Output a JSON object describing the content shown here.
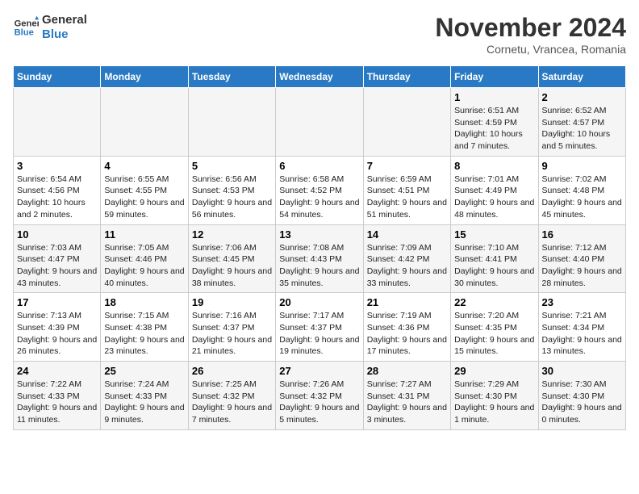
{
  "logo": {
    "line1": "General",
    "line2": "Blue"
  },
  "title": "November 2024",
  "location": "Cornetu, Vrancea, Romania",
  "days_of_week": [
    "Sunday",
    "Monday",
    "Tuesday",
    "Wednesday",
    "Thursday",
    "Friday",
    "Saturday"
  ],
  "weeks": [
    [
      {
        "day": "",
        "info": ""
      },
      {
        "day": "",
        "info": ""
      },
      {
        "day": "",
        "info": ""
      },
      {
        "day": "",
        "info": ""
      },
      {
        "day": "",
        "info": ""
      },
      {
        "day": "1",
        "info": "Sunrise: 6:51 AM\nSunset: 4:59 PM\nDaylight: 10 hours and 7 minutes."
      },
      {
        "day": "2",
        "info": "Sunrise: 6:52 AM\nSunset: 4:57 PM\nDaylight: 10 hours and 5 minutes."
      }
    ],
    [
      {
        "day": "3",
        "info": "Sunrise: 6:54 AM\nSunset: 4:56 PM\nDaylight: 10 hours and 2 minutes."
      },
      {
        "day": "4",
        "info": "Sunrise: 6:55 AM\nSunset: 4:55 PM\nDaylight: 9 hours and 59 minutes."
      },
      {
        "day": "5",
        "info": "Sunrise: 6:56 AM\nSunset: 4:53 PM\nDaylight: 9 hours and 56 minutes."
      },
      {
        "day": "6",
        "info": "Sunrise: 6:58 AM\nSunset: 4:52 PM\nDaylight: 9 hours and 54 minutes."
      },
      {
        "day": "7",
        "info": "Sunrise: 6:59 AM\nSunset: 4:51 PM\nDaylight: 9 hours and 51 minutes."
      },
      {
        "day": "8",
        "info": "Sunrise: 7:01 AM\nSunset: 4:49 PM\nDaylight: 9 hours and 48 minutes."
      },
      {
        "day": "9",
        "info": "Sunrise: 7:02 AM\nSunset: 4:48 PM\nDaylight: 9 hours and 45 minutes."
      }
    ],
    [
      {
        "day": "10",
        "info": "Sunrise: 7:03 AM\nSunset: 4:47 PM\nDaylight: 9 hours and 43 minutes."
      },
      {
        "day": "11",
        "info": "Sunrise: 7:05 AM\nSunset: 4:46 PM\nDaylight: 9 hours and 40 minutes."
      },
      {
        "day": "12",
        "info": "Sunrise: 7:06 AM\nSunset: 4:45 PM\nDaylight: 9 hours and 38 minutes."
      },
      {
        "day": "13",
        "info": "Sunrise: 7:08 AM\nSunset: 4:43 PM\nDaylight: 9 hours and 35 minutes."
      },
      {
        "day": "14",
        "info": "Sunrise: 7:09 AM\nSunset: 4:42 PM\nDaylight: 9 hours and 33 minutes."
      },
      {
        "day": "15",
        "info": "Sunrise: 7:10 AM\nSunset: 4:41 PM\nDaylight: 9 hours and 30 minutes."
      },
      {
        "day": "16",
        "info": "Sunrise: 7:12 AM\nSunset: 4:40 PM\nDaylight: 9 hours and 28 minutes."
      }
    ],
    [
      {
        "day": "17",
        "info": "Sunrise: 7:13 AM\nSunset: 4:39 PM\nDaylight: 9 hours and 26 minutes."
      },
      {
        "day": "18",
        "info": "Sunrise: 7:15 AM\nSunset: 4:38 PM\nDaylight: 9 hours and 23 minutes."
      },
      {
        "day": "19",
        "info": "Sunrise: 7:16 AM\nSunset: 4:37 PM\nDaylight: 9 hours and 21 minutes."
      },
      {
        "day": "20",
        "info": "Sunrise: 7:17 AM\nSunset: 4:37 PM\nDaylight: 9 hours and 19 minutes."
      },
      {
        "day": "21",
        "info": "Sunrise: 7:19 AM\nSunset: 4:36 PM\nDaylight: 9 hours and 17 minutes."
      },
      {
        "day": "22",
        "info": "Sunrise: 7:20 AM\nSunset: 4:35 PM\nDaylight: 9 hours and 15 minutes."
      },
      {
        "day": "23",
        "info": "Sunrise: 7:21 AM\nSunset: 4:34 PM\nDaylight: 9 hours and 13 minutes."
      }
    ],
    [
      {
        "day": "24",
        "info": "Sunrise: 7:22 AM\nSunset: 4:33 PM\nDaylight: 9 hours and 11 minutes."
      },
      {
        "day": "25",
        "info": "Sunrise: 7:24 AM\nSunset: 4:33 PM\nDaylight: 9 hours and 9 minutes."
      },
      {
        "day": "26",
        "info": "Sunrise: 7:25 AM\nSunset: 4:32 PM\nDaylight: 9 hours and 7 minutes."
      },
      {
        "day": "27",
        "info": "Sunrise: 7:26 AM\nSunset: 4:32 PM\nDaylight: 9 hours and 5 minutes."
      },
      {
        "day": "28",
        "info": "Sunrise: 7:27 AM\nSunset: 4:31 PM\nDaylight: 9 hours and 3 minutes."
      },
      {
        "day": "29",
        "info": "Sunrise: 7:29 AM\nSunset: 4:30 PM\nDaylight: 9 hours and 1 minute."
      },
      {
        "day": "30",
        "info": "Sunrise: 7:30 AM\nSunset: 4:30 PM\nDaylight: 9 hours and 0 minutes."
      }
    ]
  ]
}
